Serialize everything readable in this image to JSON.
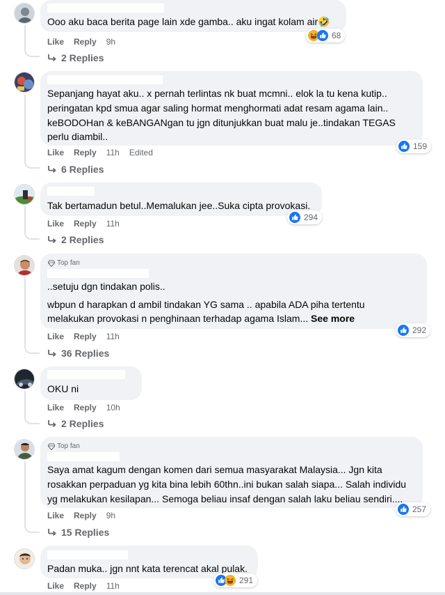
{
  "actions": {
    "like": "Like",
    "reply": "Reply",
    "edited": "Edited",
    "see_more": "See more"
  },
  "badges": {
    "top_fan": "Top fan"
  },
  "colors": {
    "like_blue": "#1877f2",
    "haha_yellow": "#f7b125",
    "bubble": "#f0f2f5",
    "meta_grey": "#65676b"
  },
  "comments": [
    {
      "text": [
        "Ooo aku baca berita page lain xde gamba.. aku ingat kolam air🤣"
      ],
      "time": "9h",
      "replies": "2 Replies",
      "reactions": {
        "icons": [
          "haha-icon",
          "like-icon"
        ],
        "count": "68"
      }
    },
    {
      "text": [
        "Sepanjang hayat aku.. x pernah terlintas nk buat mcmni.. elok la tu kena kutip..",
        "peringatan kpd smua agar saling hormat menghormati adat resam agama lain..",
        "keBODOHan & keBANGANgan tu jgn ditunjukkan buat malu je..tindakan TEGAS",
        "perlu diambil.."
      ],
      "time": "11h",
      "replies": "6 Replies",
      "reactions": {
        "icons": [
          "like-icon"
        ],
        "count": "159"
      }
    },
    {
      "text": [
        "Tak bertamadun betul..Memalukan jee..Suka cipta provokasi."
      ],
      "time": "11h",
      "replies": "2 Replies",
      "reactions": {
        "icons": [
          "like-icon"
        ],
        "count": "294"
      }
    },
    {
      "text": [
        "..setuju dgn tindakan polis..",
        "wbpun d harapkan d ambil tindakan YG sama .. apabila ADA piha tertentu",
        "melakukan provokasi n penghinaan terhadap agama Islam..."
      ],
      "time": "11h",
      "replies": "36 Replies",
      "reactions": {
        "icons": [
          "like-icon"
        ],
        "count": "292"
      }
    },
    {
      "text": [
        "OKU ni"
      ],
      "time": "10h",
      "replies": "2 Replies"
    },
    {
      "text": [
        "Saya amat kagum dengan komen dari semua masyarakat Malaysia... Jgn kita",
        "rosakkan perpaduan yg kita bina lebih 60thn..ini bukan salah siapa... Salah individu",
        "yg melakukan kesilapan... Semoga beliau insaf dengan salah laku beliau sendiri...."
      ],
      "time": "9h",
      "replies": "15 Replies",
      "reactions": {
        "icons": [
          "like-icon"
        ],
        "count": "257"
      }
    },
    {
      "text": [
        "Padan muka.. jgn nnt kata terencat akal pulak."
      ],
      "time": "11h",
      "reactions": {
        "icons": [
          "like-icon",
          "haha-icon"
        ],
        "count": "291"
      }
    }
  ]
}
